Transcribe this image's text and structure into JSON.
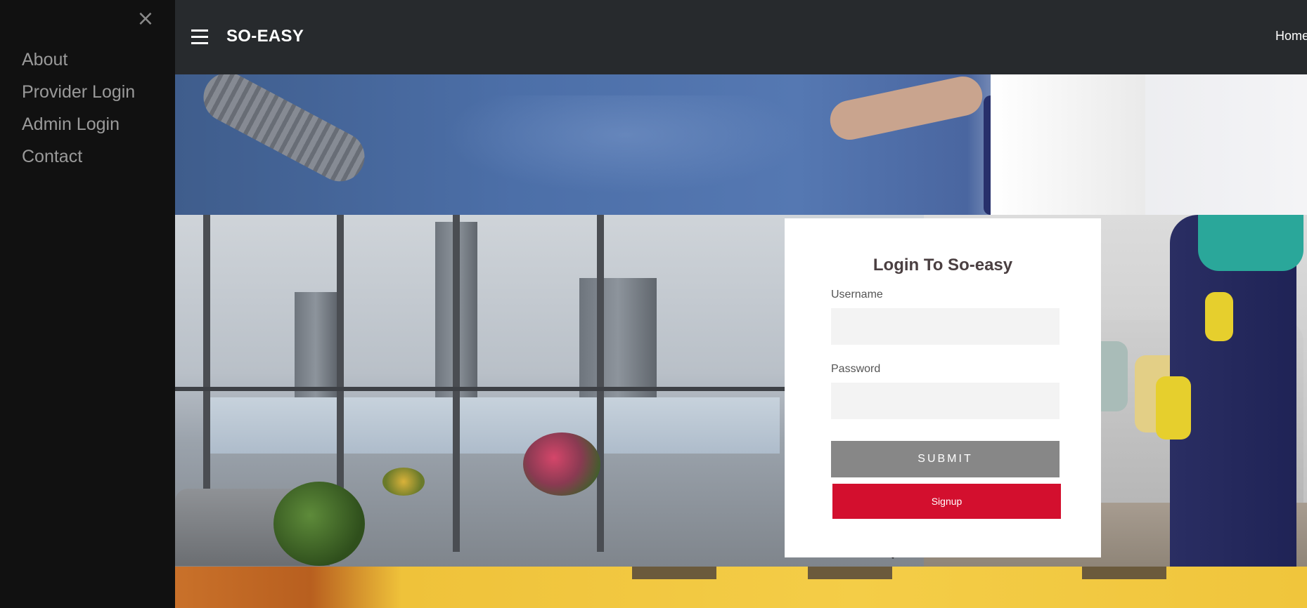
{
  "sidenav": {
    "close_glyph": "×",
    "items": [
      {
        "label": "About"
      },
      {
        "label": "Provider Login"
      },
      {
        "label": "Admin Login"
      },
      {
        "label": "Contact"
      }
    ]
  },
  "topbar": {
    "menu_icon": "hamburger-menu-icon",
    "brand": "SO-EASY",
    "nav_home": "Home"
  },
  "login": {
    "title": "Login To So-easy",
    "username_label": "Username",
    "username_value": "",
    "password_label": "Password",
    "password_value": "",
    "submit_label": "SUBMIT",
    "signup_label": "Signup"
  },
  "colors": {
    "sidenav_bg": "#111111",
    "topbar_bg": "#272a2d",
    "submit_bg": "#878787",
    "signup_bg": "#d30f2e",
    "title_text": "#4a3f41"
  }
}
